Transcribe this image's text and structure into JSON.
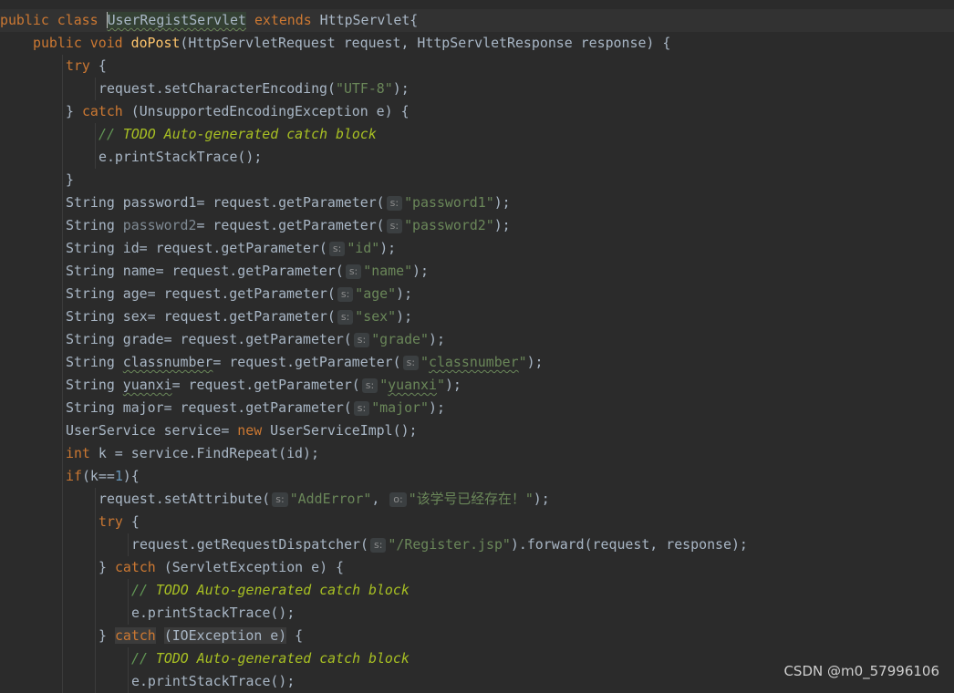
{
  "editor": {
    "lines": [
      "public class UserRegistServlet extends HttpServlet{",
      "    public void doPost(HttpServletRequest request, HttpServletResponse response) {",
      "        try {",
      "            request.setCharacterEncoding(\"UTF-8\");",
      "        } catch (UnsupportedEncodingException e) {",
      "            // TODO Auto-generated catch block",
      "            e.printStackTrace();",
      "        }",
      "        String password1= request.getParameter( s: \"password1\");",
      "        String password2= request.getParameter( s: \"password2\");",
      "        String id= request.getParameter( s: \"id\");",
      "        String name= request.getParameter( s: \"name\");",
      "        String age= request.getParameter( s: \"age\");",
      "        String sex= request.getParameter( s: \"sex\");",
      "        String grade= request.getParameter( s: \"grade\");",
      "        String classnumber= request.getParameter( s: \"classnumber\");",
      "        String yuanxi= request.getParameter( s: \"yuanxi\");",
      "        String major= request.getParameter( s: \"major\");",
      "        UserService service= new UserServiceImpl();",
      "        int k = service.FindRepeat(id);",
      "        if(k==1){",
      "            request.setAttribute( s: \"AddError\",  o: \"该学号已经存在！\");",
      "            try {",
      "                request.getRequestDispatcher( s: \"/Register.jsp\").forward(request, response);",
      "            } catch (ServletException e) {",
      "                // TODO Auto-generated catch block",
      "                e.printStackTrace();",
      "            } catch (IOException e) {",
      "                // TODO Auto-generated catch block",
      "                e.printStackTrace();"
    ]
  },
  "hint_s": "s:",
  "hint_o": "o:",
  "watermark": "CSDN @m0_57996106",
  "colors": {
    "background": "#2b2b2b",
    "keyword": "#cc7832",
    "method_decl": "#ffc66d",
    "string": "#6a8759",
    "number": "#6897bb",
    "todo_comment": "#a8c023",
    "text": "#a9b7c6"
  }
}
